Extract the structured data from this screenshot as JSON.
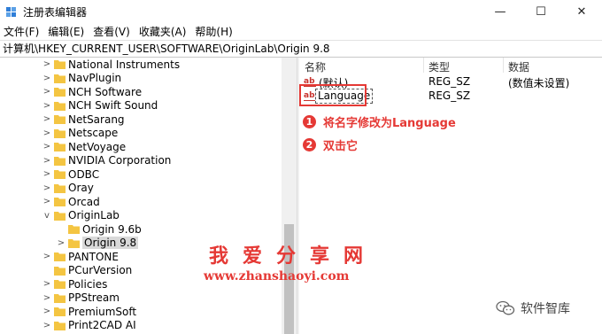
{
  "window": {
    "title": "注册表编辑器",
    "buttons": {
      "minimize": "—",
      "maximize": "☐",
      "close": "✕"
    }
  },
  "menu": [
    "文件(F)",
    "编辑(E)",
    "查看(V)",
    "收藏夹(A)",
    "帮助(H)"
  ],
  "address": "计算机\\HKEY_CURRENT_USER\\SOFTWARE\\OriginLab\\Origin 9.8",
  "tree": {
    "items": [
      {
        "label": "National Instruments",
        "expander": ">"
      },
      {
        "label": "NavPlugin",
        "expander": ">"
      },
      {
        "label": "NCH Software",
        "expander": ">"
      },
      {
        "label": "NCH Swift Sound",
        "expander": ">"
      },
      {
        "label": "NetSarang",
        "expander": ">"
      },
      {
        "label": "Netscape",
        "expander": ">"
      },
      {
        "label": "NetVoyage",
        "expander": ">"
      },
      {
        "label": "NVIDIA Corporation",
        "expander": ">"
      },
      {
        "label": "ODBC",
        "expander": ">"
      },
      {
        "label": "Oray",
        "expander": ">"
      },
      {
        "label": "Orcad",
        "expander": ">"
      },
      {
        "label": "OriginLab",
        "expander": "v"
      },
      {
        "label": "Origin 9.6b",
        "expander": ""
      },
      {
        "label": "Origin 9.8",
        "expander": ">"
      },
      {
        "label": "PANTONE",
        "expander": ">"
      },
      {
        "label": "PCurVersion",
        "expander": ""
      },
      {
        "label": "Policies",
        "expander": ">"
      },
      {
        "label": "PPStream",
        "expander": ">"
      },
      {
        "label": "PremiumSoft",
        "expander": ">"
      },
      {
        "label": "Print2CAD AI",
        "expander": ">"
      }
    ]
  },
  "list": {
    "headers": {
      "name": "名称",
      "type": "类型",
      "data": "数据"
    },
    "rows": [
      {
        "name": "(默认)",
        "type": "REG_SZ",
        "data": "(数值未设置)"
      },
      {
        "name": "Language",
        "type": "REG_SZ",
        "data": ""
      }
    ]
  },
  "annotations": {
    "step1": {
      "num": "1",
      "text": "将名字修改为Language"
    },
    "step2": {
      "num": "2",
      "text": "双击它"
    }
  },
  "watermark": {
    "line1": "我爱分享网",
    "line2": "www.zhanshaoyi.com",
    "wechat": "软件智库"
  },
  "colors": {
    "accent": "#e53935",
    "folder": "#f4c542",
    "selected": "#d9d9d9"
  }
}
